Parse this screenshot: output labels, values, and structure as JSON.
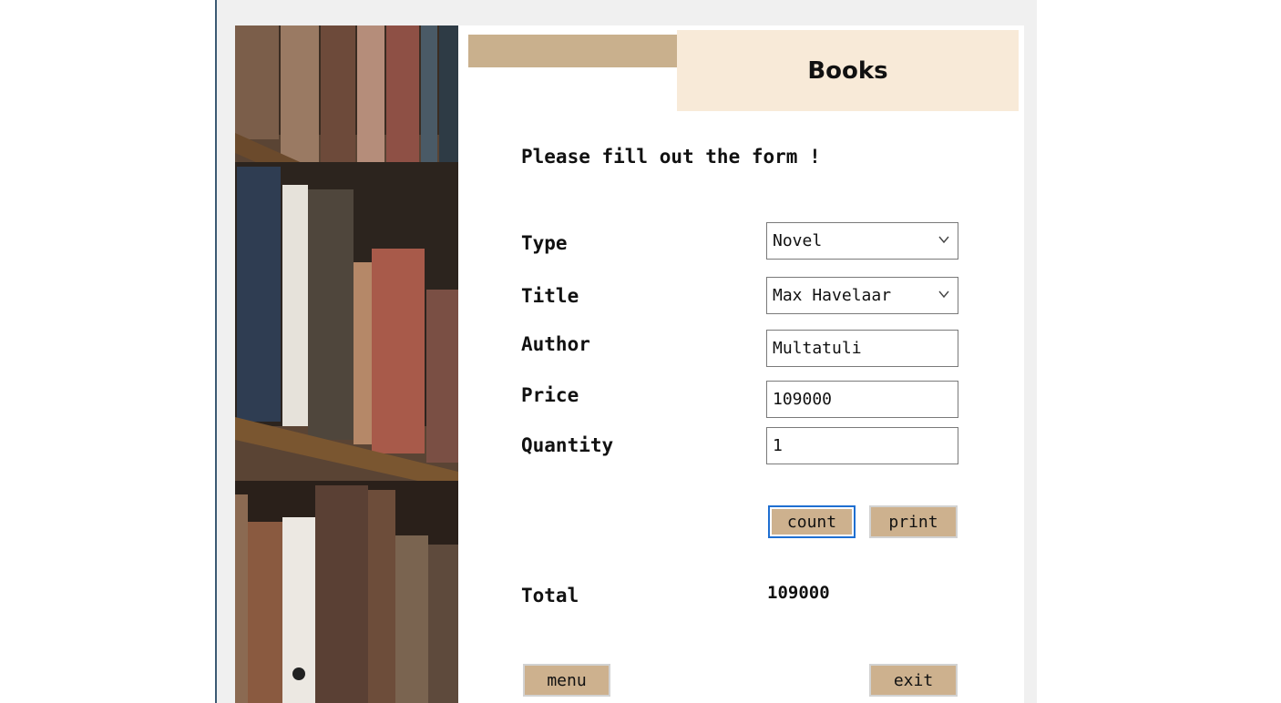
{
  "header": {
    "title": "Books"
  },
  "form": {
    "prompt": "Please fill out the form !",
    "type": {
      "label": "Type",
      "value": "Novel"
    },
    "title": {
      "label": "Title",
      "value": "Max Havelaar"
    },
    "author": {
      "label": "Author",
      "value": "Multatuli"
    },
    "price": {
      "label": "Price",
      "value": "109000"
    },
    "quantity": {
      "label": "Quantity",
      "value": "1"
    }
  },
  "actions": {
    "count_label": "count",
    "print_label": "print"
  },
  "result": {
    "label": "Total",
    "value": "109000"
  },
  "footer": {
    "menu_label": "menu",
    "exit_label": "exit"
  },
  "colors": {
    "accent_tan": "#cdb18e",
    "title_bg": "#f8ead8",
    "focus": "#1f6fd1"
  },
  "icons": {
    "dropdown": "chevron-down-icon",
    "image": "bookshelf-image"
  }
}
